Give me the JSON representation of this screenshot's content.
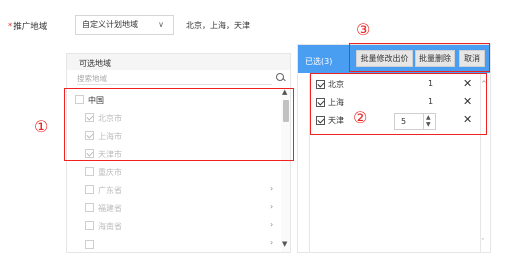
{
  "form": {
    "field_label": "推广地域",
    "required_mark": "*",
    "select_value": "自定义计划地域",
    "summary": "北京，上海，天津"
  },
  "available": {
    "title": "可选地域",
    "search_placeholder": "搜索地域",
    "items": [
      {
        "label": "中国",
        "state": "active",
        "indent": 0,
        "expandable": false
      },
      {
        "label": "北京市",
        "state": "checked-disabled",
        "indent": 1,
        "expandable": false
      },
      {
        "label": "上海市",
        "state": "checked-disabled",
        "indent": 1,
        "expandable": false
      },
      {
        "label": "天津市",
        "state": "checked-disabled",
        "indent": 1,
        "expandable": false
      },
      {
        "label": "重庆市",
        "state": "unchecked",
        "indent": 1,
        "expandable": false
      },
      {
        "label": "广东省",
        "state": "unchecked",
        "indent": 1,
        "expandable": true
      },
      {
        "label": "福建省",
        "state": "unchecked",
        "indent": 1,
        "expandable": true
      },
      {
        "label": "海南省",
        "state": "unchecked",
        "indent": 1,
        "expandable": true
      },
      {
        "label": "",
        "state": "unchecked",
        "indent": 1,
        "expandable": true
      }
    ]
  },
  "selected": {
    "title": "已选(3)",
    "buttons": {
      "batch_edit": "批量修改出价",
      "batch_delete": "批量删除",
      "cancel": "取消"
    },
    "items": [
      {
        "label": "北京",
        "value": "1"
      },
      {
        "label": "上海",
        "value": "1"
      },
      {
        "label": "天津",
        "value": "5"
      }
    ]
  },
  "annotations": {
    "one": "①",
    "two": "②",
    "three": "③"
  },
  "icons": {
    "select_chevron": "chevron-down-icon",
    "search": "search-icon",
    "expand": "chevron-right-icon",
    "remove": "close-icon",
    "scroll_up": "triangle-up-icon",
    "scroll_down": "triangle-down-icon"
  },
  "colors": {
    "accent_blue": "#4a9ef2",
    "annotation_red": "#e22222",
    "required_red": "#e4393c"
  }
}
